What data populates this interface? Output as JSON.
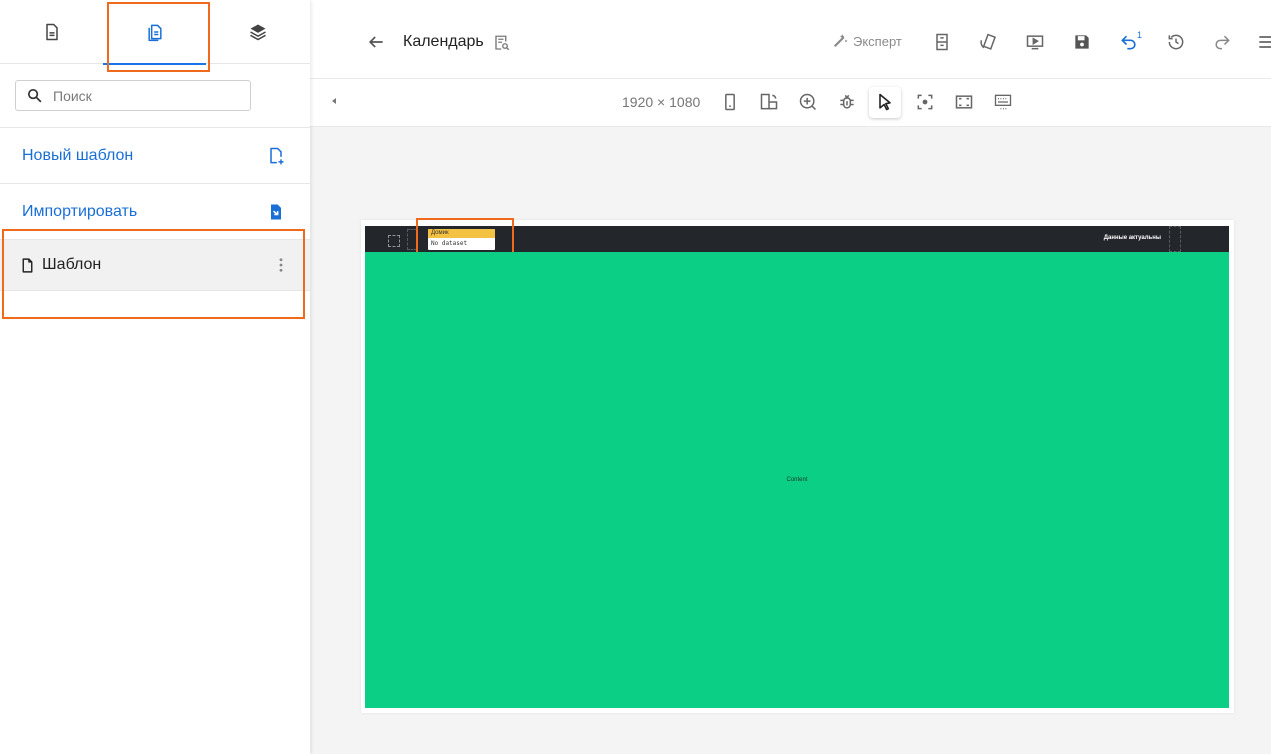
{
  "sidebar": {
    "tabs": [
      {
        "icon": "file-icon"
      },
      {
        "icon": "templates-icon",
        "active": true
      },
      {
        "icon": "layers-icon"
      }
    ],
    "search": {
      "placeholder": "Поиск"
    },
    "actions": [
      {
        "label": "Новый шаблон",
        "icon": "file-add-icon"
      },
      {
        "label": "Импортировать",
        "icon": "file-import-icon"
      }
    ],
    "templates": [
      {
        "name": "Шаблон",
        "icon": "file-outline-icon"
      }
    ]
  },
  "topbar": {
    "title": "Календарь",
    "expert_label": "Эксперт",
    "undo_count": "1"
  },
  "subbar": {
    "width": "1920",
    "times": "×",
    "height": "1080"
  },
  "preview": {
    "tag_title": "Домик",
    "tag_subtitle": "No dataset selected",
    "status": "Данные актуальны",
    "content": "Content"
  },
  "colors": {
    "accent": "#1a73e8",
    "highlight": "#f06a1d",
    "preview_header": "#23272b",
    "preview_content": "#0bcf84",
    "tag_yellow": "#f4c242"
  }
}
